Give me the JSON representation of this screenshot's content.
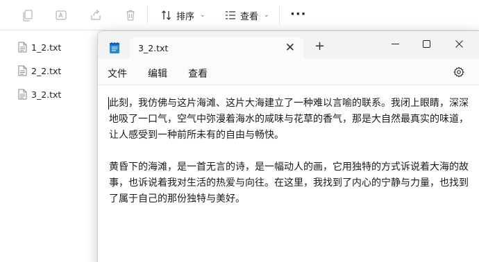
{
  "explorer": {
    "toolbar": {
      "copy_icon": "copy-icon",
      "rename_icon": "rename-icon",
      "share_icon": "share-icon",
      "delete_icon": "delete-icon",
      "sort_label": "排序",
      "view_label": "查看",
      "more_label": "···"
    },
    "files": [
      {
        "name": "1_2.txt"
      },
      {
        "name": "2_2.txt"
      },
      {
        "name": "3_2.txt"
      }
    ]
  },
  "notepad": {
    "tab_title": "3_2.txt",
    "tab_close": "✕",
    "new_tab": "+",
    "menu": {
      "file": "文件",
      "edit": "编辑",
      "view": "查看"
    },
    "content": "此刻，我仿佛与这片海滩、这片大海建立了一种难以言喻的联系。我闭上眼睛，深深地吸了一口气，空气中弥漫着海水的咸味与花草的香气，那是大自然最真实的味道，让人感受到一种前所未有的自由与畅快。\n\n黄昏下的海滩，是一首无言的诗，是一幅动人的画，它用独特的方式诉说着大海的故事，也诉说着我对生活的热爱与向往。在这里，我找到了内心的宁静与力量，也找到了属于自己的那份独特与美好。"
  },
  "colors": {
    "accent": "#1a73e8",
    "icon_gray": "#b8b8b8",
    "notepad_icon": "#1e88e5"
  }
}
